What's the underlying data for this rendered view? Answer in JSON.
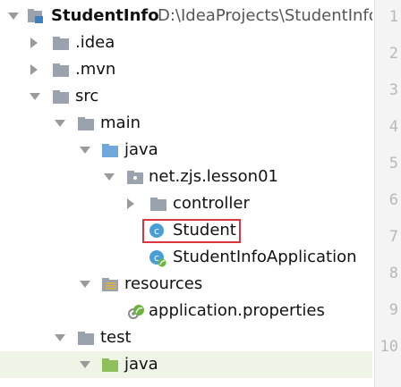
{
  "project": {
    "name": "StudentInfo",
    "path": "D:\\IdeaProjects\\StudentInfo"
  },
  "tree": {
    "idea": ".idea",
    "mvn": ".mvn",
    "src": "src",
    "main": "main",
    "java": "java",
    "package": "net.zjs.lesson01",
    "controller": "controller",
    "student": "Student",
    "app": "StudentInfoApplication",
    "resources": "resources",
    "properties": "application.properties",
    "test": "test",
    "test_java": "java"
  },
  "gutter": {
    "lines": [
      "1",
      "2",
      "3",
      "4",
      "5",
      "6",
      "7",
      "8",
      "9",
      "10"
    ]
  },
  "colors": {
    "folder": "#9aa3ad",
    "source_folder": "#6fa8dc",
    "test_folder": "#8fbf5a",
    "class_badge": "#4a9ed6",
    "spring_green": "#6db33f",
    "selection_border": "#d9363e"
  }
}
